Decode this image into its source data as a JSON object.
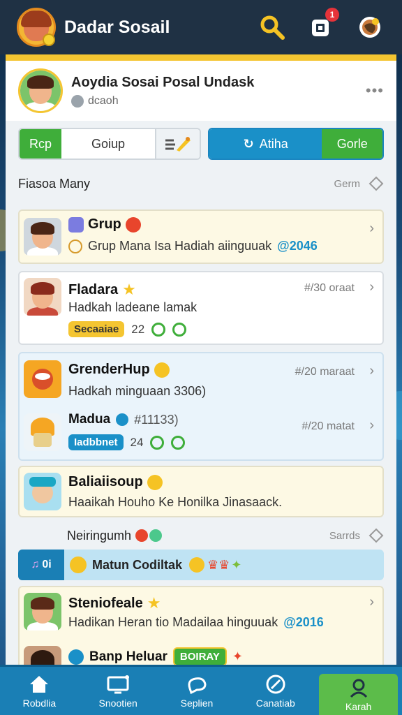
{
  "header": {
    "app_title": "Dadar Sosail",
    "notification_count": "1"
  },
  "profile": {
    "name": "Aoydia Sosai Posal Undask",
    "subtitle": "dcaoh"
  },
  "tabs": {
    "left": [
      "Rcp",
      "Goiup"
    ],
    "right": [
      "Atiha",
      "Gorle"
    ]
  },
  "section1": {
    "title": "Fiasoa Many",
    "action": "Germ"
  },
  "cards": [
    {
      "title": "Grup",
      "text": "Grup Mana Isa Hadiah aiinguuak",
      "value": "@2046"
    },
    {
      "title": "Fladara",
      "meta": "#/30 oraat",
      "text": "Hadkah ladeane lamak",
      "pill": "Secaaiae",
      "count": "22"
    },
    {
      "title": "GrenderHup",
      "meta": "#/20 maraat",
      "text": "Hadkah minguaan 3306)"
    },
    {
      "title": "Madua",
      "title_extra": "#11133)",
      "meta": "#/20 matat",
      "pill": "Iadbbnet",
      "count": "24"
    },
    {
      "title": "Baliaiisoup",
      "text": "Haaikah Houho Ke Honilka Jinasaack."
    }
  ],
  "section2": {
    "title": "Neiringumh",
    "action": "Sarrds"
  },
  "banner": {
    "label": "0i",
    "text": "Matun Codiltak"
  },
  "cards2": [
    {
      "title": "Steniofeale",
      "text": "Hadikan Heran tio Madailaa hinguuak",
      "value": "@2016"
    },
    {
      "title": "Banp Heluar",
      "pill": "BOIRAY"
    }
  ],
  "nav": [
    "Robdlia",
    "Snootien",
    "Seplien",
    "Canatiab",
    "Karah"
  ]
}
